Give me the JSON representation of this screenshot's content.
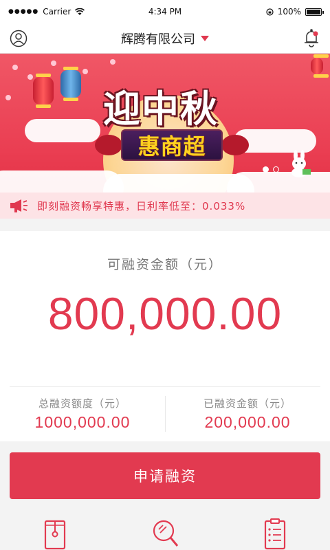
{
  "status_bar": {
    "carrier": "Carrier",
    "time": "4:34 PM",
    "battery": "100%"
  },
  "nav": {
    "title": "辉腾有限公司",
    "user_icon": "user-icon",
    "bell_icon": "bell-icon"
  },
  "banner": {
    "title_line1": "迎中秋",
    "title_line2": "惠商超",
    "pager_count": 2,
    "pager_active": 0
  },
  "notice": {
    "icon": "megaphone-icon",
    "text": "即刻融资畅享特惠，日利率低至：0.033%"
  },
  "finance": {
    "available_label": "可融资金额（元）",
    "available_value": "800,000.00",
    "total_label": "总融资额度（元）",
    "total_value": "1000,000.00",
    "used_label": "已融资金额（元）",
    "used_value": "200,000.00"
  },
  "actions": {
    "apply_label": "申请融资"
  },
  "bottom_icons": [
    "contract-icon",
    "search-icon",
    "list-icon"
  ],
  "colors": {
    "accent": "#e23a50",
    "notice_bg": "#fde3e6",
    "banner_bg": "#ea3e52"
  }
}
